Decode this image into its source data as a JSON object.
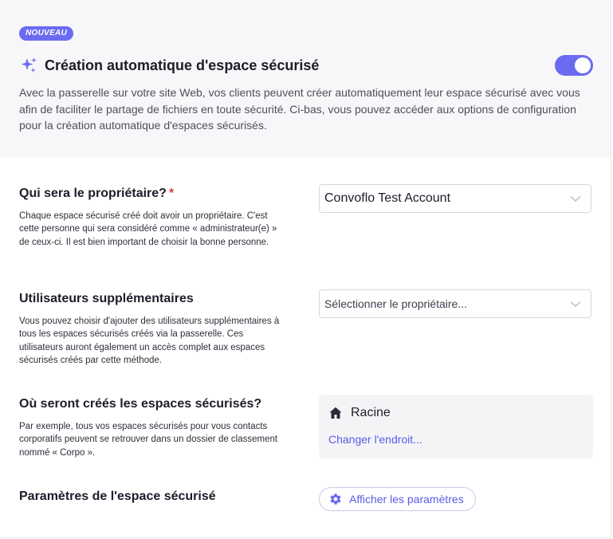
{
  "header": {
    "badge": "NOUVEAU",
    "title": "Création automatique d'espace sécurisé",
    "toggle_on": true,
    "description": "Avec la passerelle sur votre site Web, vos clients peuvent créer automatiquement leur espace sécurisé avec vous afin de faciliter le partage de fichiers en toute sécurité. Ci-bas, vous pouvez accéder aux options de configuration pour la création automatique d'espaces sécurisés."
  },
  "owner": {
    "label": "Qui sera le propriétaire?",
    "required_mark": "*",
    "description": "Chaque espace sécurisé créé doit avoir un propriétaire. C'est cette personne qui sera considéré comme « administrateur(e) » de ceux-ci. Il est bien important de choisir la bonne personne.",
    "selected": "Convoflo Test Account"
  },
  "extra_users": {
    "label": "Utilisateurs supplémentaires",
    "description": "Vous pouvez choisir d'ajouter des utilisateurs supplémentaires à tous les espaces sécurisés créés via la passerelle. Ces utilisateurs auront également un accès complet aux espaces sécurisés créés par cette méthode.",
    "placeholder": "Sélectionner le propriétaire..."
  },
  "location": {
    "label": "Où seront créés les espaces sécurisés?",
    "description": "Par exemple, tous vos espaces sécurisés pour vous contacts corporatifs peuvent se retrouver dans un dossier de classement nommé « Corpo ».",
    "current": "Racine",
    "change_link": "Changer l'endroit..."
  },
  "settings": {
    "label": "Paramètres de l'espace sécurisé",
    "button": "Afficher les paramètres"
  },
  "icons": {
    "sparkle": "sparkles-icon",
    "chevron": "chevron-down-icon",
    "home": "home-icon",
    "gear": "gear-icon"
  },
  "colors": {
    "accent": "#6b6bf2",
    "link": "#5b5be8",
    "required": "#d9413b"
  }
}
